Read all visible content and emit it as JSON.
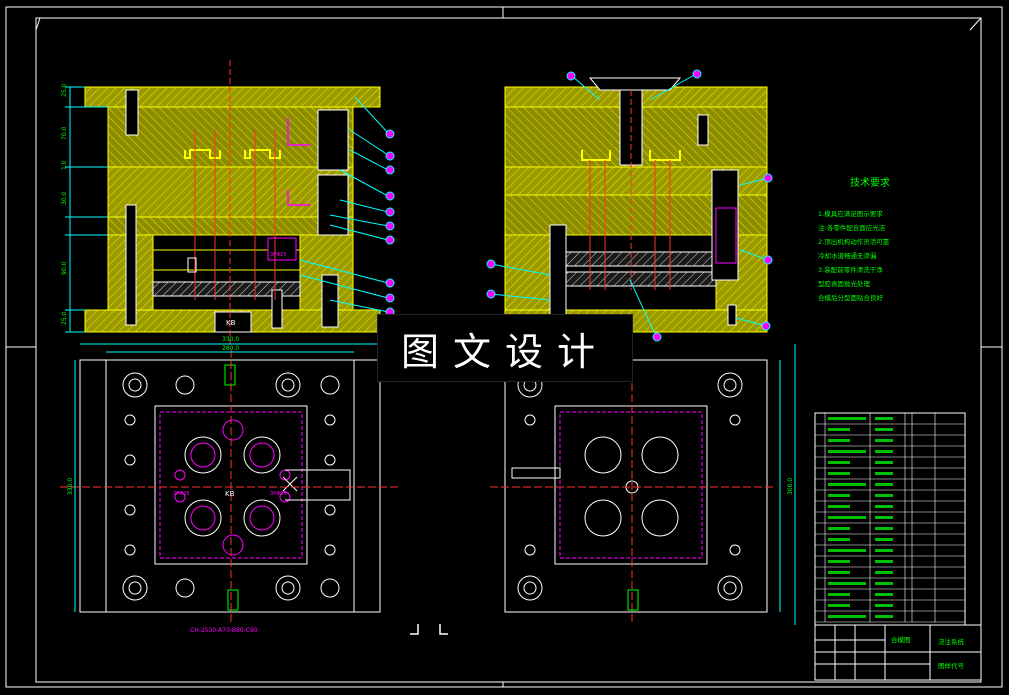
{
  "watermark_text": "图文设计",
  "tech_req": {
    "title": "技术要求",
    "lines": [
      "1.模具应满足图示要求",
      "注:各零件配合面应光洁",
      "2.顶出机构动作灵活可靠",
      "冷却水道畅通无渗漏",
      "3.装配前零件清洗干净",
      "型腔表面抛光处理",
      "合模后分型面贴合良好"
    ]
  },
  "labels": {
    "kb1": "KB",
    "kb2": "KB",
    "bottom_caption": "CH-2530-A70-B80-C90",
    "spec1": "3PΦ25",
    "spec2": "3PΦ25",
    "spec3": "3PΦ25"
  },
  "dims": {
    "left_v": [
      "25.0",
      "70.0",
      "1.0",
      "30.0",
      "90.0",
      "25.0"
    ],
    "top_h1": "330.0",
    "top_h2": "280.0",
    "side_v1": "330.0",
    "side_v2": "300.0"
  },
  "title_block": {
    "name_cell": "合模图",
    "code_cell": "图样代号",
    "part_cell": "浇注系统"
  },
  "colors": {
    "bg": "#000000",
    "border": "#ffffff",
    "yellow": "#ffff00",
    "cyan": "#00ffff",
    "green": "#00ff00",
    "magenta": "#ff00ff",
    "red": "#ff3030",
    "hatch": "#c8c800"
  }
}
